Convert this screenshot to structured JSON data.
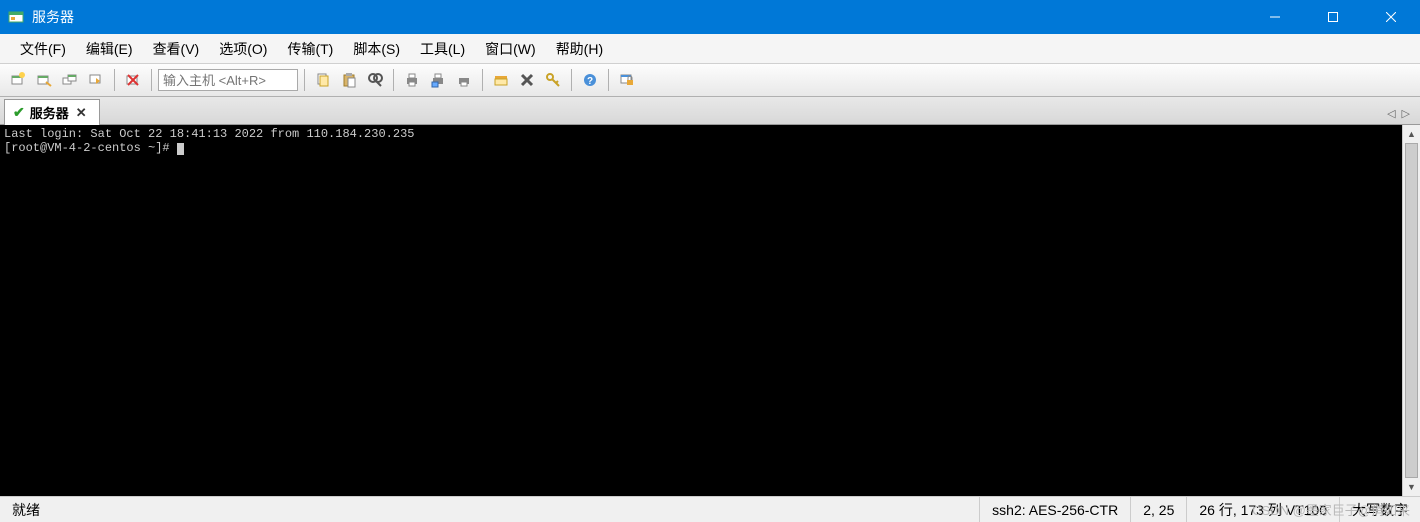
{
  "window": {
    "title": "服务器"
  },
  "menu": {
    "file": "文件(F)",
    "edit": "编辑(E)",
    "view": "查看(V)",
    "options": "选项(O)",
    "transfer": "传输(T)",
    "script": "脚本(S)",
    "tools": "工具(L)",
    "window": "窗口(W)",
    "help": "帮助(H)"
  },
  "toolbar": {
    "host_placeholder": "输入主机 <Alt+R>"
  },
  "tab": {
    "label": "服务器"
  },
  "terminal": {
    "line1": "Last login: Sat Oct 22 18:41:13 2022 from 110.184.230.235",
    "line2": "[root@VM-4-2-centos ~]# "
  },
  "status": {
    "ready": "就绪",
    "protocol": "ssh2: AES-256-CTR",
    "cursor": "2, 25",
    "size": "26 行, 173 列 VT100",
    "caps": "大写数字"
  },
  "watermark": "CSDN @墨家巨子@俏如来"
}
